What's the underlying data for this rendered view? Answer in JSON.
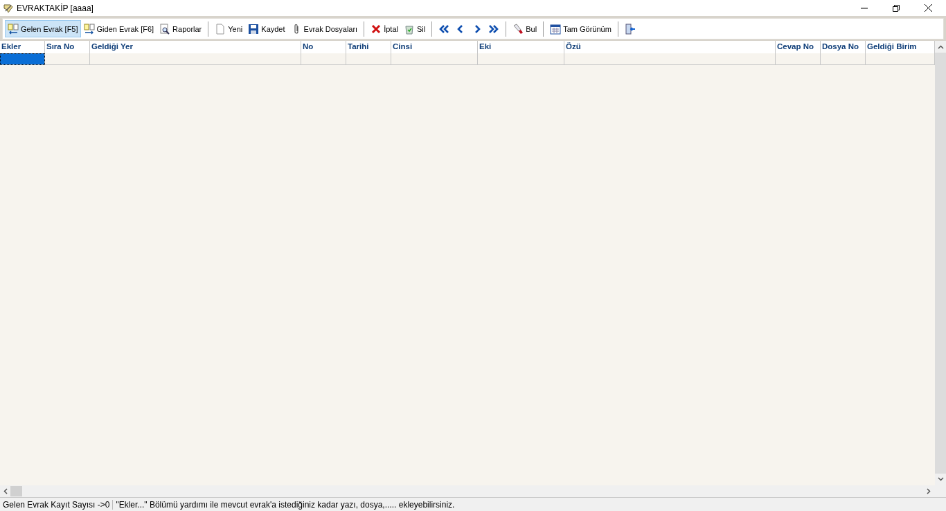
{
  "window": {
    "title": "EVRAKTAKİP [aaaa]"
  },
  "toolbar": [
    {
      "kind": "incoming",
      "label": "Gelen Evrak [F5]",
      "selected": true
    },
    {
      "kind": "outgoing",
      "label": "Giden Evrak [F6]",
      "selected": false
    },
    {
      "kind": "report",
      "label": "Raporlar",
      "selected": false
    },
    {
      "kind": "separator"
    },
    {
      "kind": "new",
      "label": "Yeni",
      "selected": false
    },
    {
      "kind": "save",
      "label": "Kaydet",
      "selected": false
    },
    {
      "kind": "attach",
      "label": "Evrak Dosyaları",
      "selected": false
    },
    {
      "kind": "separator"
    },
    {
      "kind": "cancel",
      "label": "İptal",
      "selected": false
    },
    {
      "kind": "delete",
      "label": "Sil",
      "selected": false
    },
    {
      "kind": "separator"
    },
    {
      "kind": "first",
      "selected": false
    },
    {
      "kind": "prev",
      "selected": false
    },
    {
      "kind": "next",
      "selected": false
    },
    {
      "kind": "last",
      "selected": false
    },
    {
      "kind": "separator"
    },
    {
      "kind": "find",
      "label": "Bul",
      "selected": false
    },
    {
      "kind": "separator"
    },
    {
      "kind": "fullview",
      "label": "Tam Görünüm",
      "selected": false
    },
    {
      "kind": "separator"
    },
    {
      "kind": "exit",
      "selected": false
    }
  ],
  "table": {
    "columns": [
      "Ekler",
      "Sıra No",
      "Geldiği Yer",
      "No",
      "Tarihi",
      "Cinsi",
      "Eki",
      "Özü",
      "Cevap No",
      "Dosya No",
      "Geldiği Birim"
    ],
    "rows": [
      {
        "cells": [
          {
            "selected": true
          },
          {
            "selected": false
          },
          {
            "selected": false
          },
          {
            "selected": false
          },
          {
            "selected": false
          },
          {
            "selected": false
          },
          {
            "selected": false
          },
          {
            "selected": false
          },
          {
            "selected": false
          },
          {
            "selected": false
          },
          {
            "selected": false
          }
        ]
      }
    ]
  },
  "status_bar": [
    "Gelen Evrak Kayıt Sayısı ->0",
    "\"Ekler...\" Bölümü yardımı ile mevcut evrak'a istediğiniz kadar yazı, dosya,..... ekleyebilirsiniz."
  ]
}
